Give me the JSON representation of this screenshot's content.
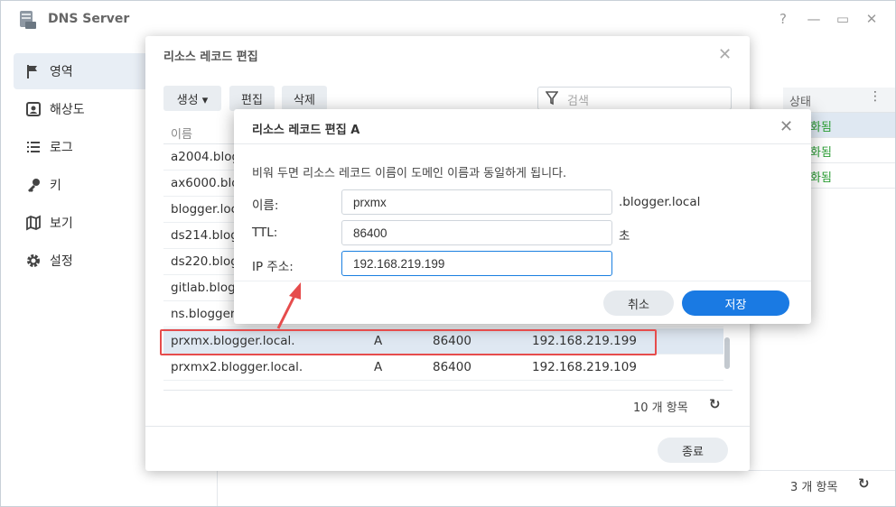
{
  "app": {
    "title": "DNS Server",
    "window_controls": [
      "?",
      "—",
      "▭",
      "✕"
    ]
  },
  "sidebar": {
    "items": [
      {
        "label": "영역",
        "icon": "flag-icon",
        "active": true
      },
      {
        "label": "해상도",
        "icon": "resolution-icon",
        "active": false
      },
      {
        "label": "로그",
        "icon": "list-icon",
        "active": false
      },
      {
        "label": "키",
        "icon": "key-icon",
        "active": false
      },
      {
        "label": "보기",
        "icon": "map-icon",
        "active": false
      },
      {
        "label": "설정",
        "icon": "gear-icon",
        "active": false
      }
    ]
  },
  "background_table": {
    "status_header": "상태",
    "status_cells": [
      "화됨",
      "화됨",
      "화됨"
    ],
    "count": "3 개 항목",
    "refresh_icon": "↻"
  },
  "record_dialog": {
    "title": "리소스 레코드 편집",
    "toolbar": {
      "create": "생성 ▾",
      "edit": "편집",
      "delete": "삭제"
    },
    "search_placeholder": "검색",
    "column_name": "이름",
    "rows": [
      {
        "name": "a2004.blogger.local.",
        "type": "",
        "ttl": "",
        "value": ""
      },
      {
        "name": "ax6000.blogger.local.",
        "type": "",
        "ttl": "",
        "value": ""
      },
      {
        "name": "blogger.local.",
        "type": "",
        "ttl": "",
        "value": ""
      },
      {
        "name": "ds214.blogger.local.",
        "type": "",
        "ttl": "",
        "value": ""
      },
      {
        "name": "ds220.blogger.local.",
        "type": "",
        "ttl": "",
        "value": ""
      },
      {
        "name": "gitlab.blogger.local.",
        "type": "",
        "ttl": "",
        "value": ""
      },
      {
        "name": "ns.blogger.local.",
        "type": "",
        "ttl": "",
        "value": ""
      },
      {
        "name": "prxmx.blogger.local.",
        "type": "A",
        "ttl": "86400",
        "value": "192.168.219.199"
      },
      {
        "name": "prxmx2.blogger.local.",
        "type": "A",
        "ttl": "86400",
        "value": "192.168.219.109"
      }
    ],
    "count": "10 개 항목",
    "refresh_icon": "↻",
    "close_button": "종료"
  },
  "edit_dialog": {
    "title": "리소스 레코드 편집 A",
    "description": "비워 두면 리소스 레코드 이름이 도메인 이름과 동일하게 됩니다.",
    "fields": {
      "name_label": "이름:",
      "name_value": "prxmx",
      "name_suffix": ".blogger.local",
      "ttl_label": "TTL:",
      "ttl_value": "86400",
      "ttl_suffix": "초",
      "ip_label": "IP 주소:",
      "ip_value": "192.168.219.199"
    },
    "cancel_button": "취소",
    "save_button": "저장"
  },
  "colors": {
    "accent": "#1a7ae3",
    "highlight": "#e64c4c",
    "status_green": "#2a9d33"
  }
}
